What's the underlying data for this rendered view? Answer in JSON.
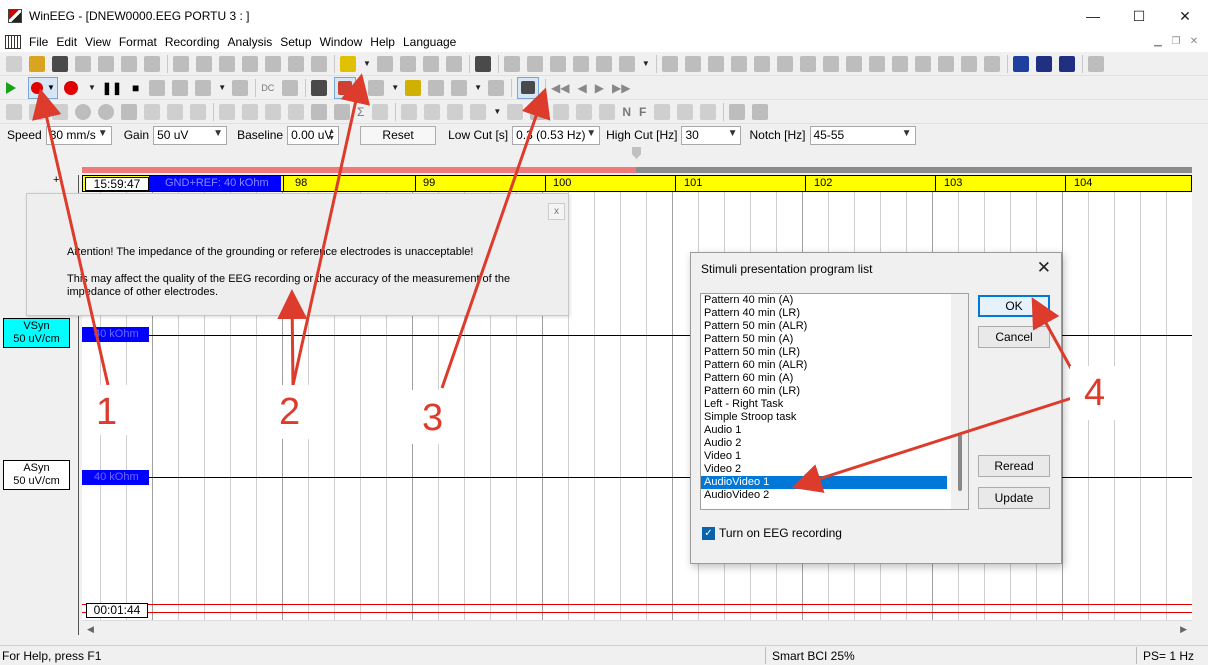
{
  "window": {
    "title": "WinEEG - [DNEW0000.EEG PORTU 3 : ]",
    "minimize": "—",
    "maximize": "☐",
    "close": "✕"
  },
  "menu": [
    "File",
    "Edit",
    "View",
    "Format",
    "Recording",
    "Analysis",
    "Setup",
    "Window",
    "Help",
    "Language"
  ],
  "settings": {
    "speed_label": "Speed",
    "speed_value": "30 mm/s",
    "gain_label": "Gain",
    "gain_value": "50 uV",
    "baseline_label": "Baseline",
    "baseline_value": "0.00 uV",
    "reset_label": "Reset",
    "lowcut_label": "Low Cut [s]",
    "lowcut_value": "0.3   (0.53 Hz)",
    "highcut_label": "High Cut [Hz]",
    "highcut_value": "30",
    "notch_label": "Notch [Hz]",
    "notch_value": "45-55"
  },
  "recording": {
    "start_time": "15:59:47",
    "gnd_label": "GND+REF: 40 kOhm",
    "seconds": [
      "98",
      "99",
      "100",
      "101",
      "102",
      "103",
      "104"
    ],
    "end_time": "00:01:44",
    "channels": [
      {
        "name": "VSyn",
        "scale": "50 uV/cm",
        "impedance": "40 kOhm"
      },
      {
        "name": "ASyn",
        "scale": "50 uV/cm",
        "impedance": "40 kOhm"
      }
    ]
  },
  "warning": {
    "line1": "Attention! The impedance of the grounding or reference electrodes is unacceptable!",
    "line2": "This may affect the quality of the EEG recording or the accuracy of the measurement of the impedance of other electrodes.",
    "close": "x"
  },
  "dialog": {
    "title": "Stimuli presentation program list",
    "close": "✕",
    "items": [
      "Pattern 40 min (A)",
      "Pattern 40 min (LR)",
      "Pattern 50 min (ALR)",
      "Pattern 50 min (A)",
      "Pattern 50 min (LR)",
      "Pattern 60 min (ALR)",
      "Pattern 60 min (A)",
      "Pattern 60 min (LR)",
      "Left - Right Task",
      "Simple Stroop task",
      "Audio 1",
      "Audio 2",
      "Video 1",
      "Video 2",
      "AudioVideo 1",
      "AudioVideo 2"
    ],
    "selected_index": 14,
    "ok": "OK",
    "cancel": "Cancel",
    "reread": "Reread",
    "update": "Update",
    "checkbox_label": "Turn on EEG recording",
    "checkbox_checked": true
  },
  "status": {
    "help": "For Help, press F1",
    "battery": "Smart BCI 25%",
    "ps": "PS= 1 Hz"
  },
  "annotations": [
    "1",
    "2",
    "3",
    "4"
  ],
  "colors": {
    "timeline": "#ffff00",
    "impedance_box": "#0000ff",
    "selected": "#0078d7",
    "annotation": "#dd3b2b",
    "record": "#e00000"
  }
}
